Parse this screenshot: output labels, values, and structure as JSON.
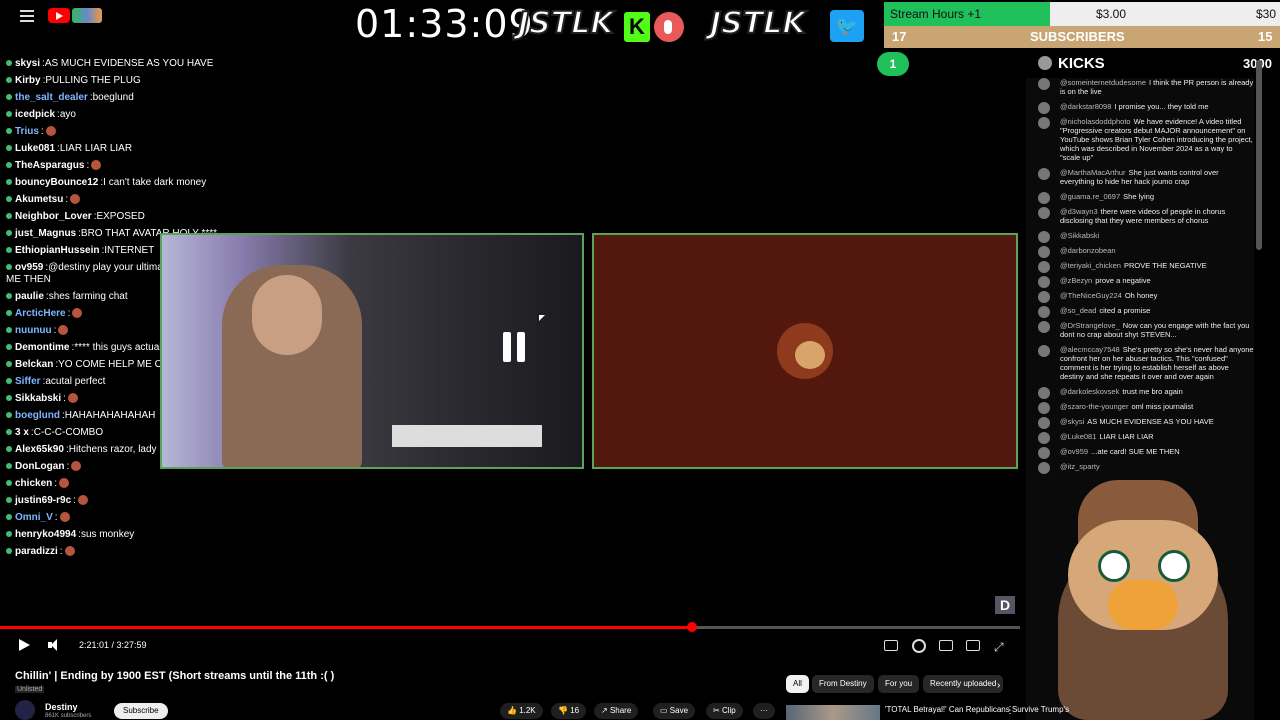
{
  "overlay": {
    "timer": "01:33:09",
    "brand_left": "JSTLK",
    "brand_right": "JSTLK",
    "kick_letter": "K",
    "twitter_glyph": "🐦",
    "stream_hours": {
      "label": "Stream Hours +1",
      "price_a": "$3.00",
      "price_b": "$30",
      "progress": 0.42
    },
    "subscribers": {
      "left": "17",
      "label": "SUBSCRIBERS",
      "right": "15"
    },
    "kicks": {
      "rank": "1",
      "label": "KICKS",
      "value": "3000"
    }
  },
  "left_chat": [
    {
      "user": "skysi",
      "msg": "AS MUCH EVIDENSE AS YOU HAVE",
      "color": "#ffffff"
    },
    {
      "user": "Kirby",
      "msg": "PULLING THE PLUG",
      "color": "#ffffff"
    },
    {
      "user": "the_salt_dealer",
      "msg": "boeglund",
      "color": "#7fb6ff"
    },
    {
      "user": "icedpick",
      "msg": "ayo",
      "color": "#ffffff"
    },
    {
      "user": "Trius",
      "msg": "",
      "color": "#7fb6ff"
    },
    {
      "user": "Luke081",
      "msg": "LIAR LIAR LIAR",
      "color": "#ffffff"
    },
    {
      "user": "TheAsparagus",
      "msg": "",
      "color": "#ffffff"
    },
    {
      "user": "bouncyBounce12",
      "msg": "I can't take dark money",
      "color": "#ffffff"
    },
    {
      "user": "Akumetsu",
      "msg": "",
      "color": "#ffffff"
    },
    {
      "user": "Neighbor_Lover",
      "msg": "EXPOSED",
      "color": "#ffffff"
    },
    {
      "user": "just_Magnus",
      "msg": "BRO THAT AVATAR HOLY ****",
      "color": "#ffffff"
    },
    {
      "user": "EthiopianHussein",
      "msg": "INTERNET",
      "color": "#ffffff"
    },
    {
      "user": "ov959",
      "msg": "@destiny play your ultimate card! SUE ME THEN",
      "color": "#ffffff"
    },
    {
      "user": "paulie",
      "msg": "shes farming chat",
      "color": "#ffffff"
    },
    {
      "user": "ArcticHere",
      "msg": "",
      "color": "#7fb6ff"
    },
    {
      "user": "nuunuu",
      "msg": "",
      "color": "#7fb6ff"
    },
    {
      "user": "Demontime",
      "msg": "**** this guys actually smart",
      "color": "#ffffff"
    },
    {
      "user": "Belckan",
      "msg": "YO COME HELP ME OUT",
      "color": "#ffffff"
    },
    {
      "user": "Siffer",
      "msg": "acutal perfect",
      "color": "#7fb6ff"
    },
    {
      "user": "Sikkabski",
      "msg": "",
      "color": "#ffffff"
    },
    {
      "user": "boeglund",
      "msg": "HAHAHAHAHAHAH",
      "color": "#7fb6ff"
    },
    {
      "user": "3 x",
      "msg": "C-C-C-COMBO",
      "color": "#ffffff"
    },
    {
      "user": "Alex65k90",
      "msg": "Hitchens razor, lady",
      "color": "#ffffff"
    },
    {
      "user": "DonLogan",
      "msg": "",
      "color": "#ffffff"
    },
    {
      "user": "chicken",
      "msg": "",
      "color": "#ffffff"
    },
    {
      "user": "justin69-r9c",
      "msg": "",
      "color": "#ffffff"
    },
    {
      "user": "Omni_V",
      "msg": "",
      "color": "#7fb6ff"
    },
    {
      "user": "henryko4994",
      "msg": "sus monkey",
      "color": "#ffffff"
    },
    {
      "user": "paradizzi",
      "msg": "",
      "color": "#ffffff"
    }
  ],
  "right_chat": [
    {
      "user": "@someinternetdudesome",
      "msg": "I think the PR person is already is on the live"
    },
    {
      "user": "@darkstar8098",
      "msg": "I promise you... they told me"
    },
    {
      "user": "@nicholasdoddphoto",
      "msg": "We have evidence! A video titled \"Progressive creators debut MAJOR announcement\" on YouTube shows Brian Tyler Cohen introducing the project, which was described in November 2024 as a way to \"scale up\""
    },
    {
      "user": "@MarthaMacArthur",
      "msg": "She just wants control over everything to hide her hack joumo crap"
    },
    {
      "user": "@guama.re_0697",
      "msg": "She lying"
    },
    {
      "user": "@d3wayn3",
      "msg": "there were videos of people in chorus disclosing that they were members of chorus"
    },
    {
      "user": "@Sikkabski",
      "msg": ""
    },
    {
      "user": "@darbonzobean",
      "msg": ""
    },
    {
      "user": "@teriyaki_chicken",
      "msg": "PROVE THE NEGATIVE"
    },
    {
      "user": "@zBezyn",
      "msg": "prove a negative"
    },
    {
      "user": "@TheNiceGuy224",
      "msg": "Oh honey"
    },
    {
      "user": "@so_dead",
      "msg": "cited a promise"
    },
    {
      "user": "@DrStrangelove_",
      "msg": "Now can you engage with the fact you dont no crap about shyt STEVEN..."
    },
    {
      "user": "@alecmccay7548",
      "msg": "She's pretty so she's never had anyone confront her on her abuser tactics. This \"confused\" comment is her trying to establish herself as above destiny and she repeats it over and over again"
    },
    {
      "user": "@darkoleskovsek",
      "msg": "trust me bro again"
    },
    {
      "user": "@szaro-the-younger",
      "msg": "oml miss journalist"
    },
    {
      "user": "@skysi",
      "msg": "AS MUCH EVIDENSE AS YOU HAVE"
    },
    {
      "user": "@Luke081",
      "msg": "LIAR LIAR LIAR"
    },
    {
      "user": "@ov959",
      "msg": "...ate card! SUE ME THEN"
    },
    {
      "user": "@itz_sparty",
      "msg": ""
    }
  ],
  "player": {
    "progress": 0.6788,
    "time_readout": "2:21:01 / 3:27:59",
    "watermark": "D"
  },
  "video": {
    "title": "Chillin' | Ending by 1900 EST (Short streams until the 11th :( )",
    "unlisted": "Unlisted",
    "channel_name": "Destiny",
    "channel_subs": "861K subscribers",
    "subscribe": "Subscribe",
    "likes": "1.2K",
    "dislikes": "16",
    "share": "Share",
    "save": "Save",
    "clip": "Clip",
    "more": "···"
  },
  "chips": {
    "all": "All",
    "from": "From Destiny",
    "for_you": "For you",
    "recent": "Recently uploaded",
    "next": "›"
  },
  "recommendation": {
    "title": "'TOTAL Betrayal!' Can Republicans Survive Trump's"
  }
}
